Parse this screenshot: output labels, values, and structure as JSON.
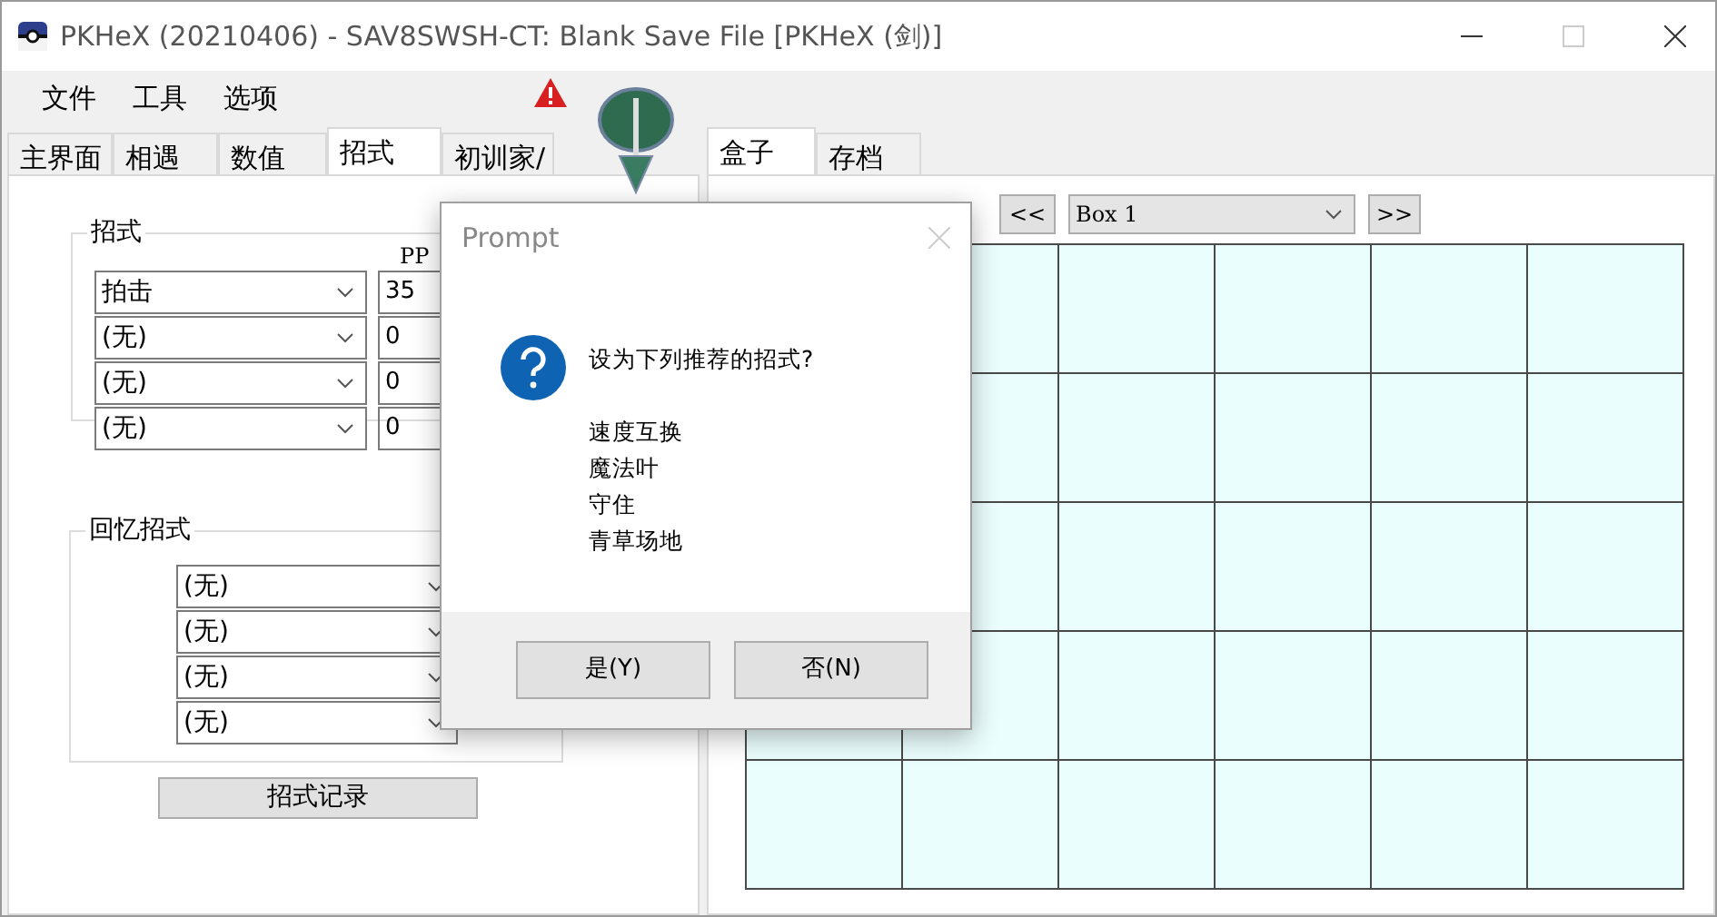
{
  "window": {
    "title": "PKHeX (20210406) - SAV8SWSH-CT: Blank Save File [PKHeX (剑)]"
  },
  "menu": [
    "文件",
    "工具",
    "选项"
  ],
  "left_tabs": [
    {
      "label": "主界面",
      "selected": false
    },
    {
      "label": "相遇",
      "selected": false
    },
    {
      "label": "数值",
      "selected": false
    },
    {
      "label": "招式",
      "selected": true
    },
    {
      "label": "初训家/",
      "selected": false
    }
  ],
  "moves": {
    "title": "招式",
    "pp_header": "PP",
    "rows": [
      {
        "move": "拍击",
        "pp": "35"
      },
      {
        "move": "(无)",
        "pp": "0"
      },
      {
        "move": "(无)",
        "pp": "0"
      },
      {
        "move": "(无)",
        "pp": "0"
      }
    ]
  },
  "relearn": {
    "title": "回忆招式",
    "rows": [
      "(无)",
      "(无)",
      "(无)",
      "(无)"
    ]
  },
  "move_log_button": "招式记录",
  "right_tabs": [
    {
      "label": "盒子",
      "selected": true
    },
    {
      "label": "存档",
      "selected": false
    }
  ],
  "box": {
    "prev": "<<",
    "name": "Box 1",
    "next": ">>"
  },
  "dialog": {
    "title": "Prompt",
    "message": "设为下列推荐的招式?",
    "moves": [
      "速度互换",
      "魔法叶",
      "守住",
      "青草场地"
    ],
    "buttons": [
      "是(Y)",
      "否(N)"
    ]
  }
}
